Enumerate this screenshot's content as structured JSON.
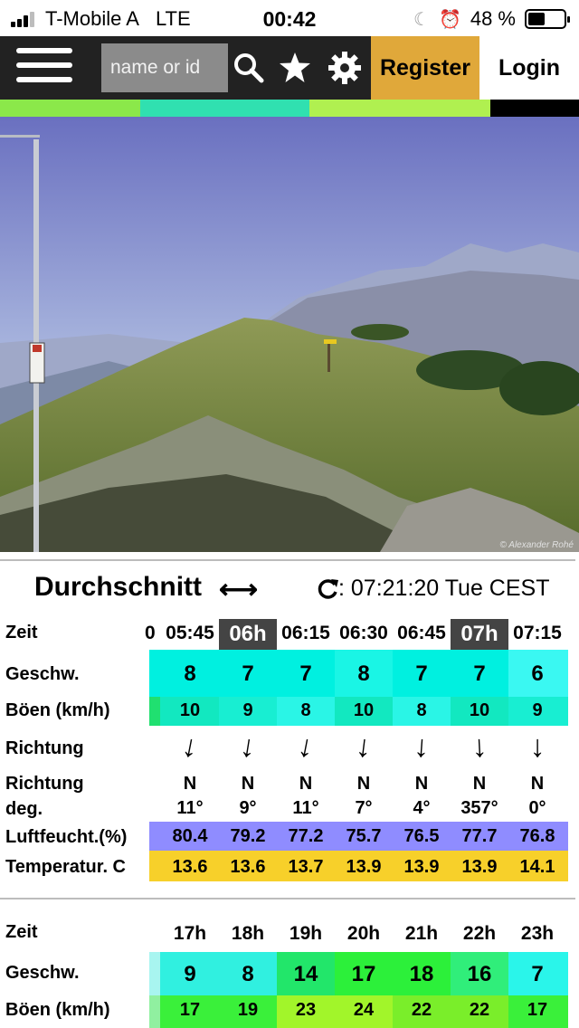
{
  "status_bar": {
    "carrier": "T-Mobile A",
    "network": "LTE",
    "time": "00:42",
    "battery": "48 %",
    "battery_level": 0.48,
    "icons": [
      "signal-icon",
      "moon-icon",
      "alarm-icon",
      "battery-icon"
    ]
  },
  "nav": {
    "search_placeholder": "name or id",
    "register": "Register",
    "login": "Login",
    "icons": [
      "menu-icon",
      "search-icon",
      "star-icon",
      "gear-icon"
    ],
    "colors": {
      "bar": "#222222",
      "register_bg": "#e0a83a"
    }
  },
  "webcam": {
    "watermark": "© Alexander Rohé"
  },
  "section": {
    "title": "Durchschnitt",
    "arrow": "⟷",
    "updated": ": 07:21:20 Tue CEST"
  },
  "labels": {
    "zeit": "Zeit",
    "geschw": "Geschw.",
    "boeen": "Böen (km/h)",
    "richtung": "Richtung",
    "richtung_deg_1": "Richtung",
    "richtung_deg_2": "deg.",
    "luft": "Luftfeucht.(%)",
    "temp": "Temperatur. C"
  },
  "table1": {
    "clipped_time": "0",
    "times": [
      "05:45",
      "06h",
      "06:15",
      "06:30",
      "06:45",
      "07h",
      "07:15"
    ],
    "speed": [
      "8",
      "7",
      "7",
      "8",
      "7",
      "7",
      "6"
    ],
    "gusts": [
      "10",
      "9",
      "8",
      "10",
      "8",
      "10",
      "9"
    ],
    "direction_arrows": [
      "↓",
      "↓",
      "↓",
      "↓",
      "↓",
      "↓",
      "↓"
    ],
    "direction_deg_values": [
      191,
      189,
      191,
      187,
      184,
      177,
      180
    ],
    "direction_letters": [
      "N",
      "N",
      "N",
      "N",
      "N",
      "N",
      "N"
    ],
    "direction_deg": [
      "11°",
      "9°",
      "11°",
      "7°",
      "4°",
      "357°",
      "0°"
    ],
    "humidity": [
      "80.4",
      "79.2",
      "77.2",
      "75.7",
      "76.5",
      "77.7",
      "76.8"
    ],
    "temperature": [
      "13.6",
      "13.6",
      "13.7",
      "13.9",
      "13.9",
      "13.9",
      "14.1"
    ]
  },
  "table2": {
    "times": [
      "17h",
      "18h",
      "19h",
      "20h",
      "21h",
      "22h",
      "23h"
    ],
    "speed": [
      "9",
      "8",
      "14",
      "17",
      "18",
      "16",
      "7"
    ],
    "gusts": [
      "17",
      "19",
      "23",
      "24",
      "22",
      "22",
      "17"
    ]
  },
  "colors": {
    "speed_cyan": "#00f0e0",
    "gust_cyan": "#10e8c0",
    "humidity": "#8f8cff",
    "temperature": "#f7d02a",
    "highlight": "#444444"
  }
}
